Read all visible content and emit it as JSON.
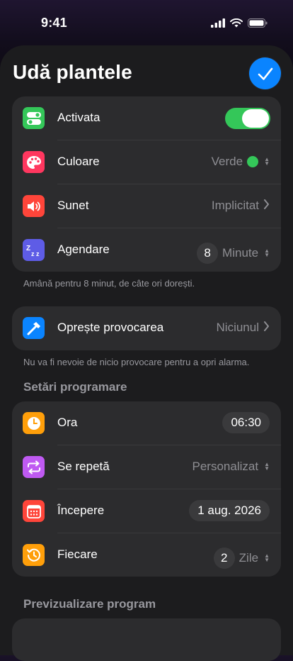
{
  "status_bar": {
    "time": "9:41"
  },
  "header": {
    "title": "Udă plantele",
    "done_icon": "checkmark-icon"
  },
  "colors": {
    "accent": "#0a84ff",
    "toggle_on": "#34c759",
    "card_bg": "#2c2c2e",
    "sheet_bg": "#1c1c1e",
    "secondary_text": "#8e8e93"
  },
  "general": {
    "rows": [
      {
        "label": "Activata",
        "icon": "toggle-icon",
        "icon_color": "#34c759",
        "enabled": true
      },
      {
        "label": "Culoare",
        "value": "Verde",
        "icon": "palette-icon",
        "icon_color": "#ff375f"
      },
      {
        "label": "Sunet",
        "value": "Implicitat",
        "icon": "speaker-icon",
        "icon_color": "#ff453a"
      },
      {
        "label": "Agendare",
        "number": "8",
        "unit": "Minute",
        "icon": "snooze-icon",
        "icon_color": "#5e5ce6"
      }
    ],
    "footnote": "Amână pentru 8 minut, de câte ori dorești."
  },
  "challenge": {
    "label": "Oprește provocarea",
    "value": "Niciunul",
    "icon": "hammer-icon",
    "icon_color": "#0a84ff",
    "footnote": "Nu va fi nevoie de nicio provocare pentru a opri alarma."
  },
  "schedule": {
    "header": "Setări programare",
    "rows": [
      {
        "label": "Ora",
        "value": "06:30",
        "icon": "clock-icon",
        "icon_color": "#ff9f0a"
      },
      {
        "label": "Se repetă",
        "value": "Personalizat",
        "icon": "repeat-icon",
        "icon_color": "#bf5af2"
      },
      {
        "label": "Începere",
        "value": "1 aug. 2026",
        "icon": "calendar-icon",
        "icon_color": "#ff453a"
      },
      {
        "label": "Fiecare",
        "number": "2",
        "unit": "Zile",
        "icon": "history-icon",
        "icon_color": "#ff9f0a"
      }
    ]
  },
  "preview": {
    "header": "Previzualizare program"
  }
}
